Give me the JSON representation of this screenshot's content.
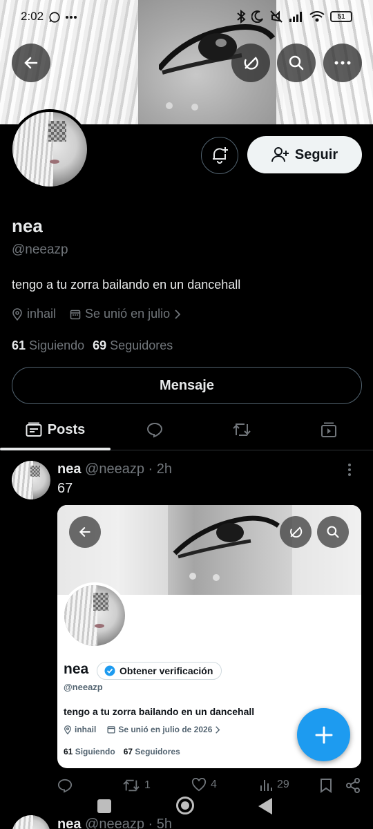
{
  "status_bar": {
    "time": "2:02",
    "battery": "51"
  },
  "profile": {
    "name": "nea",
    "handle": "@neeazp",
    "bio": "tengo a tu zorra bailando en un dancehall",
    "location": "inhail",
    "joined": "Se unió en julio",
    "following_count": "61",
    "following_label": "Siguiendo",
    "followers_count": "69",
    "followers_label": "Seguidores",
    "follow_label": "Seguir",
    "message_label": "Mensaje"
  },
  "tabs": {
    "posts_label": "Posts"
  },
  "post": {
    "name": "nea",
    "handle": "@neeazp",
    "sep": "·",
    "time": "2h",
    "text": "67",
    "replies": "",
    "reposts": "1",
    "likes": "4",
    "views": "29"
  },
  "embedded": {
    "name": "nea",
    "verify_label": "Obtener verificación",
    "handle": "@neeazp",
    "bio": "tengo a tu zorra bailando en un dancehall",
    "location": "inhail",
    "joined": "Se unió en julio de 2026",
    "following_count": "61",
    "following_label": "Siguiendo",
    "followers_count": "67",
    "followers_label": "Seguidores"
  },
  "next_post": {
    "name": "nea",
    "handle": "@neeazp",
    "time": "5h"
  },
  "colors": {
    "accent": "#1d9bf0",
    "muted": "#71767b",
    "background": "#000000",
    "text": "#e7e9ea"
  }
}
